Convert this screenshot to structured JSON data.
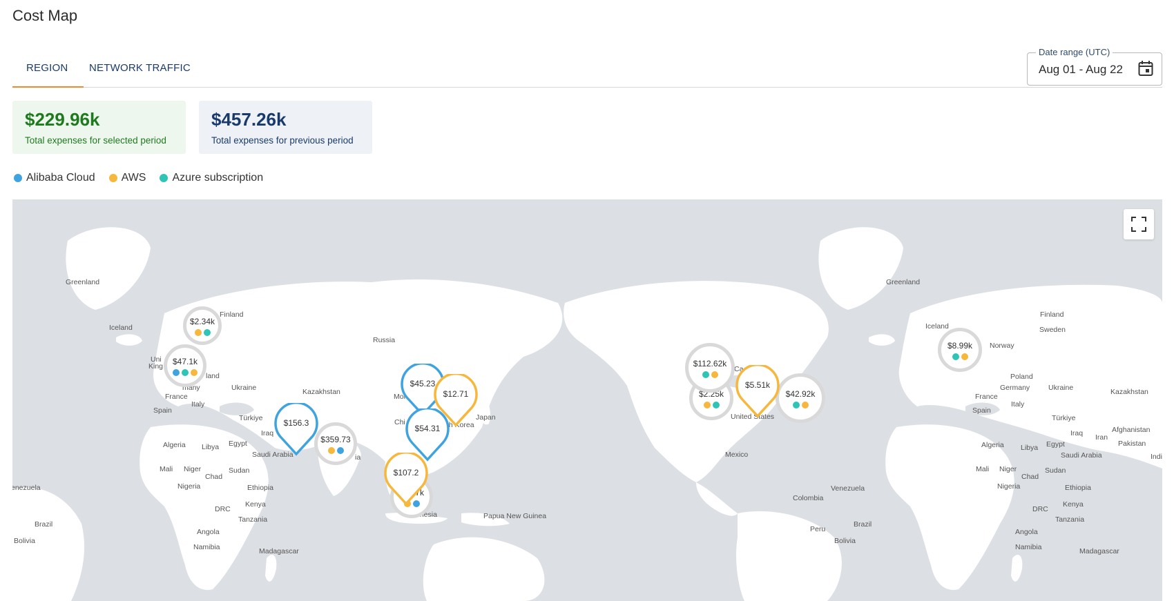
{
  "page": {
    "title": "Cost Map"
  },
  "tabs": [
    {
      "label": "REGION",
      "active": true
    },
    {
      "label": "NETWORK TRAFFIC",
      "active": false
    }
  ],
  "date_range": {
    "label": "Date range (UTC)",
    "value": "Aug 01 - Aug 22",
    "icon": "calendar-icon"
  },
  "summary": {
    "current": {
      "amount": "$229.96k",
      "description": "Total expenses for selected period",
      "color": "#1f7a1f"
    },
    "previous": {
      "amount": "$457.26k",
      "description": "Total expenses for previous period",
      "color": "#1a3a6b"
    }
  },
  "legend": [
    {
      "label": "Alibaba Cloud",
      "color": "#3fa3e0"
    },
    {
      "label": "AWS",
      "color": "#f6b73c"
    },
    {
      "label": "Azure subscription",
      "color": "#2ec4b6"
    }
  ],
  "map": {
    "fullscreen_icon": "fullscreen-icon",
    "place_labels": [
      "Greenland",
      "Iceland",
      "Finland",
      "Russia",
      "Kazakhstan",
      "Mong",
      "Ukraine",
      "Uni",
      "King",
      "land",
      "many",
      "France",
      "Spain",
      "Italy",
      "Türkiye",
      "Iraq",
      "Saudi Arabia",
      "Egypt",
      "Libya",
      "Algeria",
      "Mali",
      "Niger",
      "Chad",
      "Sudan",
      "Nigeria",
      "Ethiopia",
      "Kenya",
      "DRC",
      "Tanzania",
      "Angola",
      "Namibia",
      "Madagascar",
      "Brazil",
      "Bolivia",
      "enezuela",
      "Chi",
      "uth Korea",
      "Japan",
      "onesia",
      "Papua New Guinea",
      "ia",
      "Ca",
      "United States",
      "Mexico",
      "Colombia",
      "Venezuela",
      "Peru",
      "Greenland",
      "Iceland",
      "Finland",
      "Sweden",
      "Norway",
      "Poland",
      "Germany",
      "Ukraine",
      "Kazakhstan",
      "France",
      "Spain",
      "Italy",
      "Türkiye",
      "Afghanistan",
      "Iran",
      "Pakistan",
      "Indi",
      "Iraq",
      "Egypt",
      "Libya",
      "Algeria",
      "Saudi Arabia",
      "Mali",
      "Niger",
      "Chad",
      "Sudan",
      "Nigeria",
      "Ethiopia",
      "Kenya",
      "DRC",
      "Tanzania",
      "Angola",
      "Namibia",
      "Madagascar",
      "Brazil",
      "Bolivia"
    ],
    "clusters": [
      {
        "value": "$2.34k",
        "providers": [
          "AWS",
          "Azure subscription"
        ]
      },
      {
        "value": "$47.1k",
        "providers": [
          "Alibaba Cloud",
          "Azure subscription",
          "AWS"
        ]
      },
      {
        "value": "$359.73",
        "providers": [
          "AWS",
          "Alibaba Cloud"
        ]
      },
      {
        "value": "$1.17k",
        "providers": [
          "AWS",
          "Alibaba Cloud"
        ]
      },
      {
        "value": "$2.25k",
        "providers": [
          "AWS",
          "Azure subscription"
        ]
      },
      {
        "value": "$112.62k",
        "providers": [
          "Azure subscription",
          "AWS"
        ]
      },
      {
        "value": "$42.92k",
        "providers": [
          "Azure subscription",
          "AWS"
        ]
      },
      {
        "value": "$8.99k",
        "providers": [
          "Azure subscription",
          "AWS"
        ]
      }
    ],
    "pins": [
      {
        "value": "$156.3",
        "provider": "Alibaba Cloud"
      },
      {
        "value": "$45.23",
        "provider": "Alibaba Cloud"
      },
      {
        "value": "$12.71",
        "provider": "AWS"
      },
      {
        "value": "$54.31",
        "provider": "Alibaba Cloud"
      },
      {
        "value": "$107.2",
        "provider": "AWS"
      },
      {
        "value": "$5.51k",
        "provider": "AWS"
      }
    ]
  }
}
